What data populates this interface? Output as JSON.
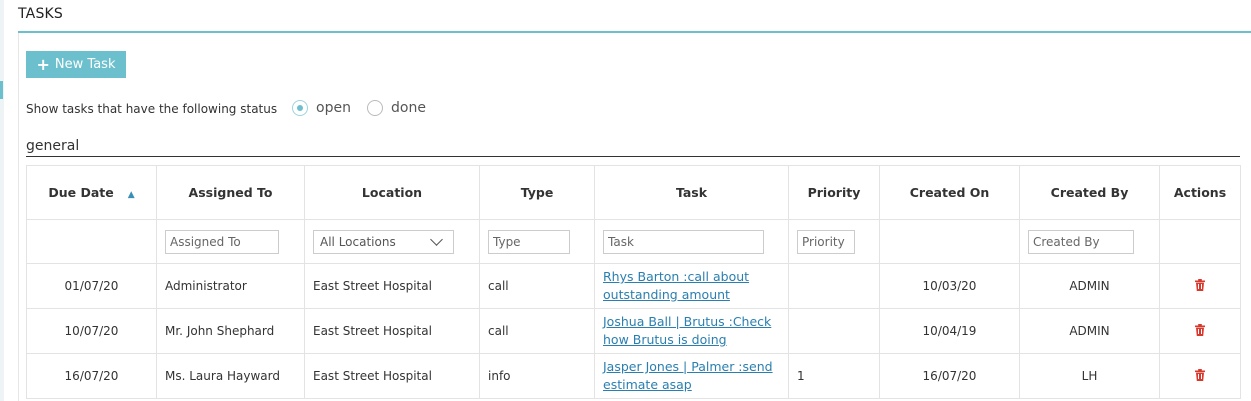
{
  "header": {
    "title": "TASKS"
  },
  "toolbar": {
    "new_task_label": "New Task"
  },
  "status_filter": {
    "label": "Show tasks that have the following status",
    "options": [
      {
        "label": "open",
        "checked": true
      },
      {
        "label": "done",
        "checked": false
      }
    ]
  },
  "section": {
    "title": "general"
  },
  "table": {
    "columns": [
      "Due Date",
      "Assigned To",
      "Location",
      "Type",
      "Task",
      "Priority",
      "Created On",
      "Created By",
      "Actions"
    ],
    "sort_indicator": "▲",
    "filters": {
      "assigned_to_placeholder": "Assigned To",
      "location_selected": "All Locations",
      "type_placeholder": "Type",
      "task_placeholder": "Task",
      "priority_placeholder": "Priority",
      "created_by_placeholder": "Created By"
    },
    "rows": [
      {
        "due_date": "01/07/20",
        "assigned_to": "Administrator",
        "location": "East Street Hospital",
        "type": "call",
        "task": "Rhys Barton :call about outstanding amount",
        "priority": "",
        "created_on": "10/03/20",
        "created_by": "ADMIN"
      },
      {
        "due_date": "10/07/20",
        "assigned_to": "Mr. John Shephard",
        "location": "East Street Hospital",
        "type": "call",
        "task": "Joshua Ball | Brutus :Check how Brutus is doing",
        "priority": "",
        "created_on": "10/04/19",
        "created_by": "ADMIN"
      },
      {
        "due_date": "16/07/20",
        "assigned_to": "Ms. Laura Hayward",
        "location": "East Street Hospital",
        "type": "info",
        "task": "Jasper Jones | Palmer :send estimate asap",
        "priority": "1",
        "created_on": "16/07/20",
        "created_by": "LH"
      }
    ]
  },
  "colors": {
    "accent": "#6cc0ce",
    "link": "#2a7fb0",
    "sorted_header": "#3a8fb7",
    "delete": "#d9382c"
  },
  "icons": {
    "new_task": "plus-icon",
    "sort": "sort-asc-icon",
    "row_action": "trash-icon",
    "select": "chevron-down-icon"
  }
}
